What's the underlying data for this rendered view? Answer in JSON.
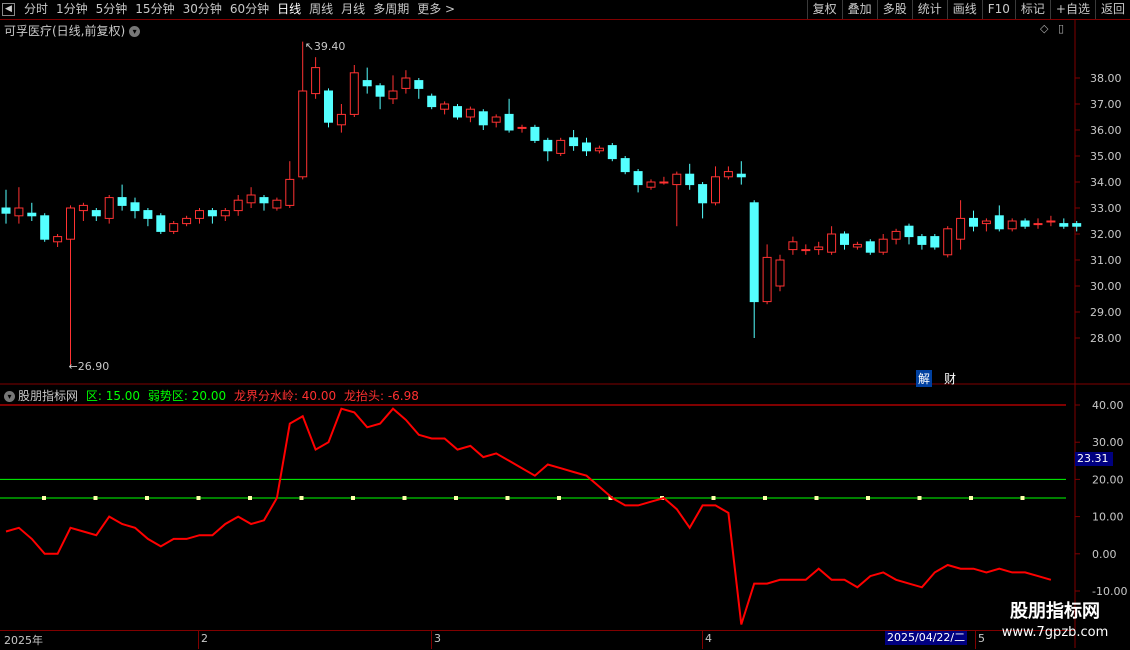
{
  "toolbar": {
    "periods": [
      "分时",
      "1分钟",
      "5分钟",
      "15分钟",
      "30分钟",
      "60分钟",
      "日线",
      "周线",
      "月线",
      "多周期",
      "更多 >"
    ],
    "active_period": "日线",
    "tools": [
      "复权",
      "叠加",
      "多股",
      "统计",
      "画线",
      "F10",
      "标记",
      "+自选",
      "返回"
    ]
  },
  "stock": {
    "title": "可孚医疗(日线,前复权)",
    "high_mark": "39.40",
    "low_mark": "26.90"
  },
  "price_axis": [
    "38.00",
    "37.00",
    "36.00",
    "35.00",
    "34.00",
    "33.00",
    "32.00",
    "31.00",
    "30.00",
    "29.00",
    "28.00"
  ],
  "candles": [
    {
      "o": 33.0,
      "c": 32.8,
      "h": 33.7,
      "l": 32.4
    },
    {
      "o": 32.7,
      "c": 33.0,
      "h": 33.8,
      "l": 32.4
    },
    {
      "o": 32.8,
      "c": 32.7,
      "h": 33.2,
      "l": 32.5
    },
    {
      "o": 32.7,
      "c": 31.8,
      "h": 32.8,
      "l": 31.7
    },
    {
      "o": 31.7,
      "c": 31.9,
      "h": 32.0,
      "l": 31.5
    },
    {
      "o": 31.8,
      "c": 33.0,
      "h": 33.1,
      "l": 26.9
    },
    {
      "o": 32.9,
      "c": 33.1,
      "h": 33.2,
      "l": 32.5
    },
    {
      "o": 32.9,
      "c": 32.7,
      "h": 33.0,
      "l": 32.5
    },
    {
      "o": 32.6,
      "c": 33.4,
      "h": 33.5,
      "l": 32.4
    },
    {
      "o": 33.4,
      "c": 33.1,
      "h": 33.9,
      "l": 32.9
    },
    {
      "o": 33.2,
      "c": 32.9,
      "h": 33.4,
      "l": 32.6
    },
    {
      "o": 32.9,
      "c": 32.6,
      "h": 33.0,
      "l": 32.3
    },
    {
      "o": 32.7,
      "c": 32.1,
      "h": 32.8,
      "l": 32.0
    },
    {
      "o": 32.1,
      "c": 32.4,
      "h": 32.5,
      "l": 32.0
    },
    {
      "o": 32.4,
      "c": 32.6,
      "h": 32.7,
      "l": 32.3
    },
    {
      "o": 32.6,
      "c": 32.9,
      "h": 33.0,
      "l": 32.4
    },
    {
      "o": 32.9,
      "c": 32.7,
      "h": 33.0,
      "l": 32.4
    },
    {
      "o": 32.7,
      "c": 32.9,
      "h": 33.0,
      "l": 32.5
    },
    {
      "o": 32.9,
      "c": 33.3,
      "h": 33.5,
      "l": 32.7
    },
    {
      "o": 33.2,
      "c": 33.5,
      "h": 33.8,
      "l": 33.0
    },
    {
      "o": 33.4,
      "c": 33.2,
      "h": 33.5,
      "l": 32.9
    },
    {
      "o": 33.0,
      "c": 33.3,
      "h": 33.4,
      "l": 32.9
    },
    {
      "o": 33.1,
      "c": 34.1,
      "h": 34.8,
      "l": 33.0
    },
    {
      "o": 34.2,
      "c": 37.5,
      "h": 39.4,
      "l": 34.1
    },
    {
      "o": 37.4,
      "c": 38.4,
      "h": 38.8,
      "l": 37.2
    },
    {
      "o": 37.5,
      "c": 36.3,
      "h": 37.6,
      "l": 36.1
    },
    {
      "o": 36.2,
      "c": 36.6,
      "h": 37.0,
      "l": 35.9
    },
    {
      "o": 36.6,
      "c": 38.2,
      "h": 38.5,
      "l": 36.5
    },
    {
      "o": 37.9,
      "c": 37.7,
      "h": 38.4,
      "l": 37.4
    },
    {
      "o": 37.7,
      "c": 37.3,
      "h": 37.8,
      "l": 36.8
    },
    {
      "o": 37.2,
      "c": 37.5,
      "h": 38.1,
      "l": 37.0
    },
    {
      "o": 37.6,
      "c": 38.0,
      "h": 38.3,
      "l": 37.4
    },
    {
      "o": 37.9,
      "c": 37.6,
      "h": 38.0,
      "l": 37.2
    },
    {
      "o": 37.3,
      "c": 36.9,
      "h": 37.4,
      "l": 36.8
    },
    {
      "o": 36.8,
      "c": 37.0,
      "h": 37.1,
      "l": 36.6
    },
    {
      "o": 36.9,
      "c": 36.5,
      "h": 37.0,
      "l": 36.4
    },
    {
      "o": 36.5,
      "c": 36.8,
      "h": 36.9,
      "l": 36.3
    },
    {
      "o": 36.7,
      "c": 36.2,
      "h": 36.8,
      "l": 36.0
    },
    {
      "o": 36.3,
      "c": 36.5,
      "h": 36.6,
      "l": 36.1
    },
    {
      "o": 36.6,
      "c": 36.0,
      "h": 37.2,
      "l": 35.9
    },
    {
      "o": 36.1,
      "c": 36.1,
      "h": 36.2,
      "l": 35.9
    },
    {
      "o": 36.1,
      "c": 35.6,
      "h": 36.2,
      "l": 35.5
    },
    {
      "o": 35.6,
      "c": 35.2,
      "h": 35.7,
      "l": 34.8
    },
    {
      "o": 35.1,
      "c": 35.6,
      "h": 35.7,
      "l": 35.0
    },
    {
      "o": 35.7,
      "c": 35.4,
      "h": 36.0,
      "l": 35.2
    },
    {
      "o": 35.5,
      "c": 35.2,
      "h": 35.7,
      "l": 35.0
    },
    {
      "o": 35.2,
      "c": 35.3,
      "h": 35.4,
      "l": 35.1
    },
    {
      "o": 35.4,
      "c": 34.9,
      "h": 35.5,
      "l": 34.8
    },
    {
      "o": 34.9,
      "c": 34.4,
      "h": 35.0,
      "l": 34.3
    },
    {
      "o": 34.4,
      "c": 33.9,
      "h": 34.5,
      "l": 33.6
    },
    {
      "o": 33.8,
      "c": 34.0,
      "h": 34.1,
      "l": 33.7
    },
    {
      "o": 34.0,
      "c": 34.0,
      "h": 34.2,
      "l": 33.9
    },
    {
      "o": 33.9,
      "c": 34.3,
      "h": 34.4,
      "l": 32.3
    },
    {
      "o": 34.3,
      "c": 33.9,
      "h": 34.7,
      "l": 33.7
    },
    {
      "o": 33.9,
      "c": 33.2,
      "h": 34.0,
      "l": 32.6
    },
    {
      "o": 33.2,
      "c": 34.2,
      "h": 34.6,
      "l": 33.1
    },
    {
      "o": 34.2,
      "c": 34.4,
      "h": 34.6,
      "l": 34.1
    },
    {
      "o": 34.3,
      "c": 34.2,
      "h": 34.8,
      "l": 33.9
    },
    {
      "o": 33.2,
      "c": 29.4,
      "h": 33.3,
      "l": 28.0
    },
    {
      "o": 29.4,
      "c": 31.1,
      "h": 31.6,
      "l": 29.3
    },
    {
      "o": 30.0,
      "c": 31.0,
      "h": 31.2,
      "l": 29.8
    },
    {
      "o": 31.4,
      "c": 31.7,
      "h": 31.9,
      "l": 31.2
    },
    {
      "o": 31.4,
      "c": 31.4,
      "h": 31.6,
      "l": 31.2
    },
    {
      "o": 31.4,
      "c": 31.5,
      "h": 31.7,
      "l": 31.2
    },
    {
      "o": 31.3,
      "c": 32.0,
      "h": 32.3,
      "l": 31.2
    },
    {
      "o": 32.0,
      "c": 31.6,
      "h": 32.1,
      "l": 31.4
    },
    {
      "o": 31.5,
      "c": 31.6,
      "h": 31.7,
      "l": 31.4
    },
    {
      "o": 31.7,
      "c": 31.3,
      "h": 31.8,
      "l": 31.2
    },
    {
      "o": 31.3,
      "c": 31.8,
      "h": 32.0,
      "l": 31.2
    },
    {
      "o": 31.8,
      "c": 32.1,
      "h": 32.2,
      "l": 31.6
    },
    {
      "o": 32.3,
      "c": 31.9,
      "h": 32.4,
      "l": 31.6
    },
    {
      "o": 31.9,
      "c": 31.6,
      "h": 32.0,
      "l": 31.4
    },
    {
      "o": 31.9,
      "c": 31.5,
      "h": 32.0,
      "l": 31.4
    },
    {
      "o": 31.2,
      "c": 32.2,
      "h": 32.3,
      "l": 31.1
    },
    {
      "o": 31.8,
      "c": 32.6,
      "h": 33.3,
      "l": 31.4
    },
    {
      "o": 32.6,
      "c": 32.3,
      "h": 32.9,
      "l": 32.1
    },
    {
      "o": 32.4,
      "c": 32.5,
      "h": 32.6,
      "l": 32.1
    },
    {
      "o": 32.7,
      "c": 32.2,
      "h": 33.1,
      "l": 32.1
    },
    {
      "o": 32.2,
      "c": 32.5,
      "h": 32.6,
      "l": 32.1
    },
    {
      "o": 32.5,
      "c": 32.3,
      "h": 32.6,
      "l": 32.2
    },
    {
      "o": 32.4,
      "c": 32.4,
      "h": 32.6,
      "l": 32.2
    },
    {
      "o": 32.5,
      "c": 32.5,
      "h": 32.7,
      "l": 32.3
    },
    {
      "o": 32.4,
      "c": 32.3,
      "h": 32.6,
      "l": 32.2
    },
    {
      "o": 32.4,
      "c": 32.3,
      "h": 32.5,
      "l": 32.1
    }
  ],
  "indicator": {
    "name": "股朋指标网",
    "items": [
      {
        "label": "区: 15.00",
        "color": "#00ff00"
      },
      {
        "label": "弱势区: 20.00",
        "color": "#00ff00"
      },
      {
        "label": "龙界分水岭: 40.00",
        "color": "#ff3030"
      },
      {
        "label": "龙抬头: -6.98",
        "color": "#ff3030"
      }
    ],
    "axis": [
      "40.00",
      "30.00",
      "20.00",
      "10.00",
      "0.00",
      "-10.00"
    ],
    "current_value": "23.31",
    "levels": [
      15,
      20,
      40
    ],
    "line_values": [
      6,
      7,
      4,
      0,
      0,
      7,
      6,
      5,
      10,
      8,
      7,
      4,
      2,
      4,
      4,
      5,
      5,
      8,
      10,
      8,
      9,
      15,
      35,
      37,
      28,
      30,
      39,
      38,
      34,
      35,
      39,
      36,
      32,
      31,
      31,
      28,
      29,
      26,
      27,
      25,
      23,
      21,
      24,
      23,
      22,
      21,
      18,
      15,
      13,
      13,
      14,
      15,
      12,
      7,
      13,
      13,
      11,
      -19,
      -8,
      -8,
      -7,
      -7,
      -7,
      -4,
      -7,
      -7,
      -9,
      -6,
      -5,
      -7,
      -8,
      -9,
      -5,
      -3,
      -4,
      -4,
      -5,
      -4,
      -5,
      -5,
      -6,
      -7
    ]
  },
  "finance_tags": [
    "解",
    "财"
  ],
  "date_axis": {
    "labels": [
      "2025年",
      "2",
      "3",
      "4",
      "5"
    ],
    "cursor_date": "2025/04/22/二"
  },
  "watermark": {
    "main": "股朋指标网",
    "url": "www.7gpzb.com"
  },
  "colors": {
    "up": "#ff3232",
    "down": "#54ffff",
    "grid": "#800000",
    "indicator_line": "#ff0000",
    "level_line": "#00ff00"
  }
}
